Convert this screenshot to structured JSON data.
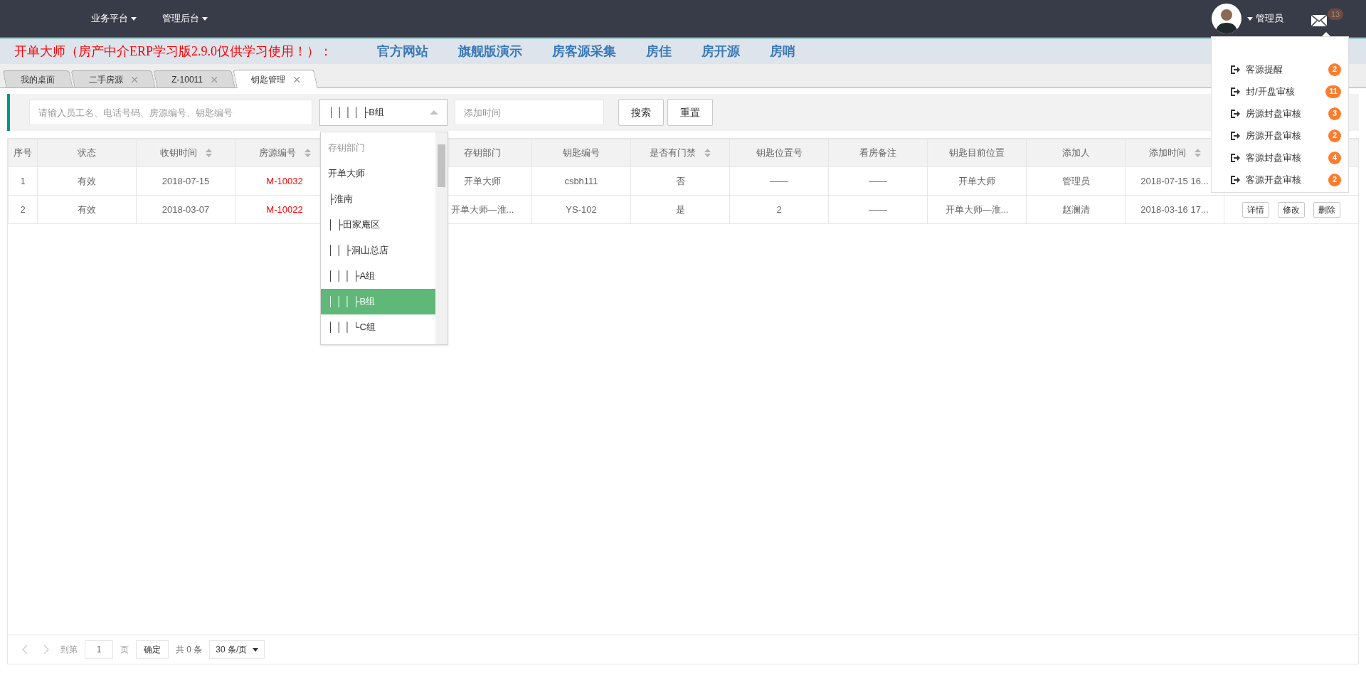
{
  "nav": {
    "menus": [
      {
        "label": "业务平台"
      },
      {
        "label": "管理后台"
      }
    ],
    "user": {
      "name": "管理员"
    },
    "mail": {
      "count": "13"
    }
  },
  "banner": {
    "title": "开单大师（房产中介ERP学习版2.9.0仅供学习使用！）：",
    "links": [
      "官方网站",
      "旗舰版演示",
      "房客源采集",
      "房佳",
      "房开源",
      "房哨"
    ]
  },
  "tabs": [
    {
      "label": "我的桌面",
      "selected": false,
      "closable": false
    },
    {
      "label": "二手房源",
      "selected": false,
      "closable": true
    },
    {
      "label": "Z-10011",
      "selected": false,
      "closable": true
    },
    {
      "label": "钥匙管理",
      "selected": true,
      "closable": true
    }
  ],
  "filters": {
    "search": {
      "placeholder": "请输入员工名、电话号码、房源编号、钥匙编号"
    },
    "department": {
      "value": "│ │ │ │ ├B组",
      "expanded": true
    },
    "date": {
      "placeholder": "添加时间"
    },
    "buttons": [
      "搜索",
      "重置"
    ]
  },
  "dropdown": {
    "options": [
      {
        "label": "存钥部门",
        "kind": "placeholder",
        "selected": false
      },
      {
        "label": "开单大师",
        "kind": "option",
        "selected": false
      },
      {
        "label": "├淮南",
        "kind": "option",
        "selected": false
      },
      {
        "label": "│ ├田家庵区",
        "kind": "option",
        "selected": false
      },
      {
        "label": "│ │ ├洞山总店",
        "kind": "option",
        "selected": false
      },
      {
        "label": "│ │ │ ├A组",
        "kind": "option",
        "selected": false
      },
      {
        "label": "│ │ │ ├B组",
        "kind": "option",
        "selected": true
      },
      {
        "label": "│ │ │ └C组",
        "kind": "option",
        "selected": false
      }
    ]
  },
  "table": {
    "columns": [
      {
        "label": "序号",
        "sortable": false
      },
      {
        "label": "状态",
        "sortable": false
      },
      {
        "label": "收钥时间",
        "sortable": true
      },
      {
        "label": "房源编号",
        "sortable": true,
        "highlight": true
      },
      {
        "label": "存钥部门",
        "sortable": false
      },
      {
        "label": "钥匙编号",
        "sortable": false
      },
      {
        "label": "是否有门禁",
        "sortable": true
      },
      {
        "label": "钥匙位置号",
        "sortable": false
      },
      {
        "label": "看房备注",
        "sortable": false
      },
      {
        "label": "钥匙目前位置",
        "sortable": false
      },
      {
        "label": "添加人",
        "sortable": false
      },
      {
        "label": "添加时间",
        "sortable": true
      }
    ],
    "rows": [
      {
        "cells": [
          "1",
          "有效",
          "2018-07-15",
          "M-10032",
          "开单大师",
          "csbh111",
          "否",
          "——",
          "——",
          "开单大师",
          "管理员",
          "2018-07-15 16..."
        ]
      },
      {
        "cells": [
          "2",
          "有效",
          "2018-03-07",
          "M-10022",
          "开单大师—淮...",
          "YS-102",
          "是",
          "2",
          "——",
          "开单大师—淮...",
          "赵澜清",
          "2018-03-16 17..."
        ],
        "actions": [
          "详情",
          "修改",
          "删除"
        ]
      }
    ]
  },
  "notifications": [
    {
      "label": "客源提醒",
      "count": "2"
    },
    {
      "label": "封/开盘审核",
      "count": "11"
    },
    {
      "label": "房源封盘审核",
      "count": "3"
    },
    {
      "label": "房源开盘审核",
      "count": "2"
    },
    {
      "label": "客源封盘审核",
      "count": "4"
    },
    {
      "label": "客源开盘审核",
      "count": "2"
    }
  ],
  "pagination": {
    "goto": "到第",
    "page": "1",
    "page_unit": "页",
    "confirm": "确定",
    "total": "共 0 条",
    "page_size": "30 条/页"
  }
}
